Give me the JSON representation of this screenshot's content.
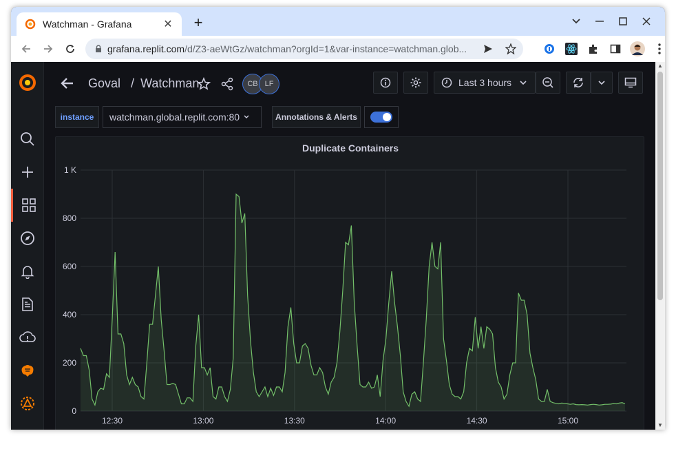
{
  "browser": {
    "tab_title": "Watchman - Grafana",
    "url_host": "grafana.replit.com",
    "url_path": "/d/Z3-aeWtGz/watchman?orgId=1&var-instance=watchman.glob..."
  },
  "header": {
    "folder": "Goval",
    "separator": "/",
    "dashboard": "Watchman",
    "avatars": [
      "CB",
      "LF"
    ],
    "time_range": "Last 3 hours"
  },
  "variables": {
    "instance_label": "instance",
    "instance_value": "watchman.global.replit.com:80",
    "annotations_label": "Annotations & Alerts",
    "annotations_enabled": true
  },
  "colors": {
    "series_line": "#73bf69",
    "accent": "#f55f3e",
    "link_blue": "#6e9fff",
    "toggle_blue": "#3d71d9"
  },
  "chart_data": {
    "type": "area",
    "title": "Duplicate Containers",
    "xlabel": "",
    "ylabel": "",
    "ylim": [
      0,
      1000
    ],
    "y_ticks": [
      "0",
      "200",
      "400",
      "600",
      "800",
      "1 K"
    ],
    "x_ticks": [
      "12:30",
      "13:00",
      "13:30",
      "14:00",
      "14:30",
      "15:00"
    ],
    "grid": true,
    "series": [
      {
        "values": [
          260,
          230,
          230,
          170,
          50,
          25,
          80,
          95,
          90,
          155,
          140,
          380,
          660,
          320,
          320,
          280,
          150,
          110,
          140,
          110,
          100,
          60,
          50,
          200,
          360,
          360,
          480,
          600,
          380,
          250,
          110,
          110,
          115,
          110,
          70,
          30,
          30,
          55,
          55,
          40,
          270,
          400,
          180,
          180,
          150,
          180,
          60,
          50,
          100,
          100,
          60,
          40,
          90,
          220,
          900,
          890,
          780,
          820,
          480,
          290,
          160,
          80,
          60,
          80,
          100,
          60,
          95,
          65,
          100,
          100,
          80,
          160,
          350,
          430,
          280,
          200,
          200,
          270,
          280,
          260,
          190,
          150,
          150,
          180,
          160,
          100,
          70,
          120,
          140,
          200,
          330,
          500,
          700,
          690,
          770,
          450,
          270,
          110,
          100,
          100,
          120,
          95,
          100,
          150,
          60,
          210,
          300,
          450,
          580,
          450,
          350,
          230,
          80,
          40,
          20,
          70,
          80,
          50,
          40,
          200,
          380,
          600,
          700,
          600,
          590,
          700,
          300,
          210,
          110,
          70,
          60,
          60,
          50,
          80,
          200,
          260,
          250,
          390,
          260,
          350,
          260,
          350,
          340,
          320,
          180,
          120,
          100,
          50,
          70,
          150,
          200,
          200,
          490,
          460,
          460,
          400,
          240,
          180,
          130,
          50,
          40,
          40,
          90,
          40,
          35,
          32,
          30,
          33,
          32,
          30,
          28,
          30,
          27,
          26,
          27,
          26,
          25,
          27,
          28,
          27,
          25,
          26,
          28,
          28,
          29,
          31,
          30,
          33,
          35,
          30
        ]
      }
    ]
  }
}
